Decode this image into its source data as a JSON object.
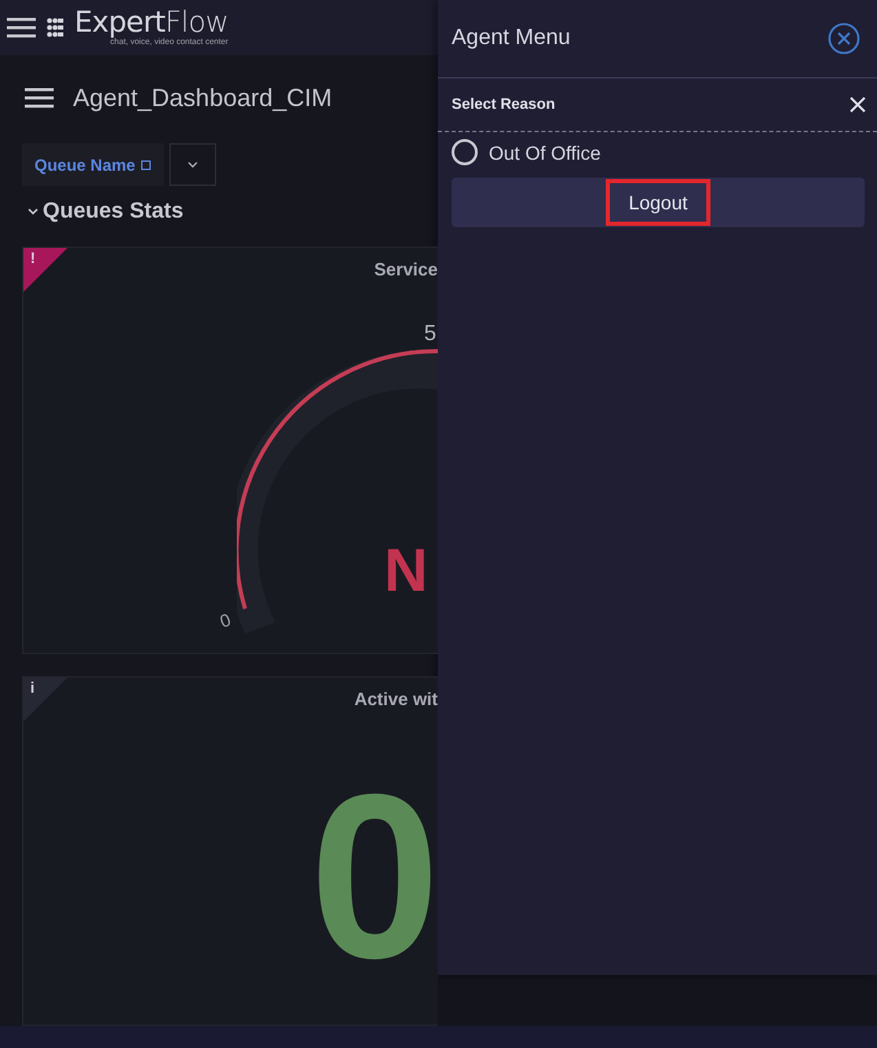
{
  "topbar": {
    "logo": "**Expert**Flow",
    "tagline": "chat, voice, video contact center"
  },
  "dashboard": {
    "title": "Agent_Dashboard_CIM",
    "filter": {
      "label": "Queue Name"
    },
    "section": {
      "title": "Queues Stats",
      "expanded": true
    },
    "panels": [
      {
        "kind": "gauge",
        "title": "Service",
        "corner": "!",
        "color": "#a8175a",
        "min_label": "0",
        "max_label": "5",
        "value": "N"
      },
      {
        "kind": "stat",
        "title": "Active wit",
        "corner": "i",
        "color": "#262833",
        "value": "0"
      }
    ]
  },
  "agent_menu": {
    "title": "Agent Menu",
    "section_title": "Select Reason",
    "reasons": [
      {
        "label": "Out Of Office",
        "selected": false
      }
    ],
    "button": "Logout",
    "button_highlighted": true
  }
}
